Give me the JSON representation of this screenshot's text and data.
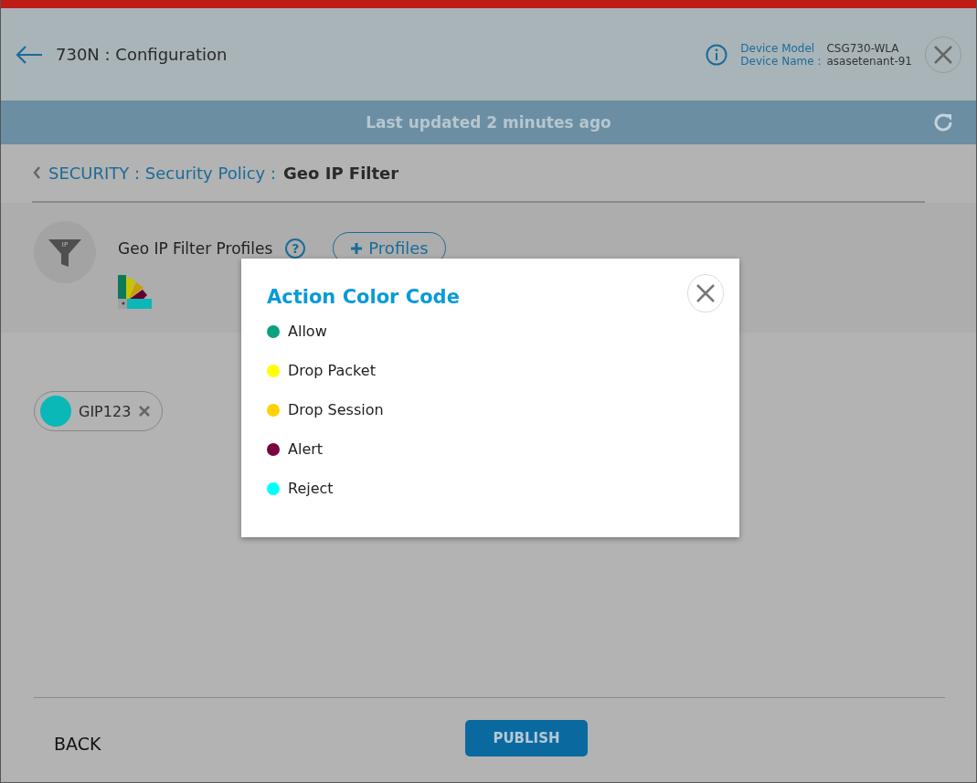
{
  "header": {
    "title": "730N : Configuration",
    "device_model_label": "Device Model",
    "device_model": "CSG730-WLA",
    "device_name_label": "Device Name :",
    "device_name": "asasetenant-91"
  },
  "status_band": {
    "text": "Last updated 2 minutes ago"
  },
  "breadcrumb": {
    "links": [
      "SECURITY : Security Policy :"
    ],
    "current": "Geo IP Filter"
  },
  "profiles_panel": {
    "icon_text": "IP",
    "title": "Geo IP Filter Profiles",
    "help": "?",
    "add_button": "Profiles"
  },
  "chips": [
    {
      "label": "GIP123"
    }
  ],
  "footer": {
    "back": "BACK",
    "publish": "PUBLISH"
  },
  "modal": {
    "title": "Action Color Code",
    "items": [
      {
        "label": "Allow",
        "color": "#0aa17e"
      },
      {
        "label": "Drop Packet",
        "color": "#ffff00"
      },
      {
        "label": "Drop Session",
        "color": "#ffd200"
      },
      {
        "label": "Alert",
        "color": "#7a0040"
      },
      {
        "label": "Reject",
        "color": "#00ffff"
      }
    ]
  }
}
